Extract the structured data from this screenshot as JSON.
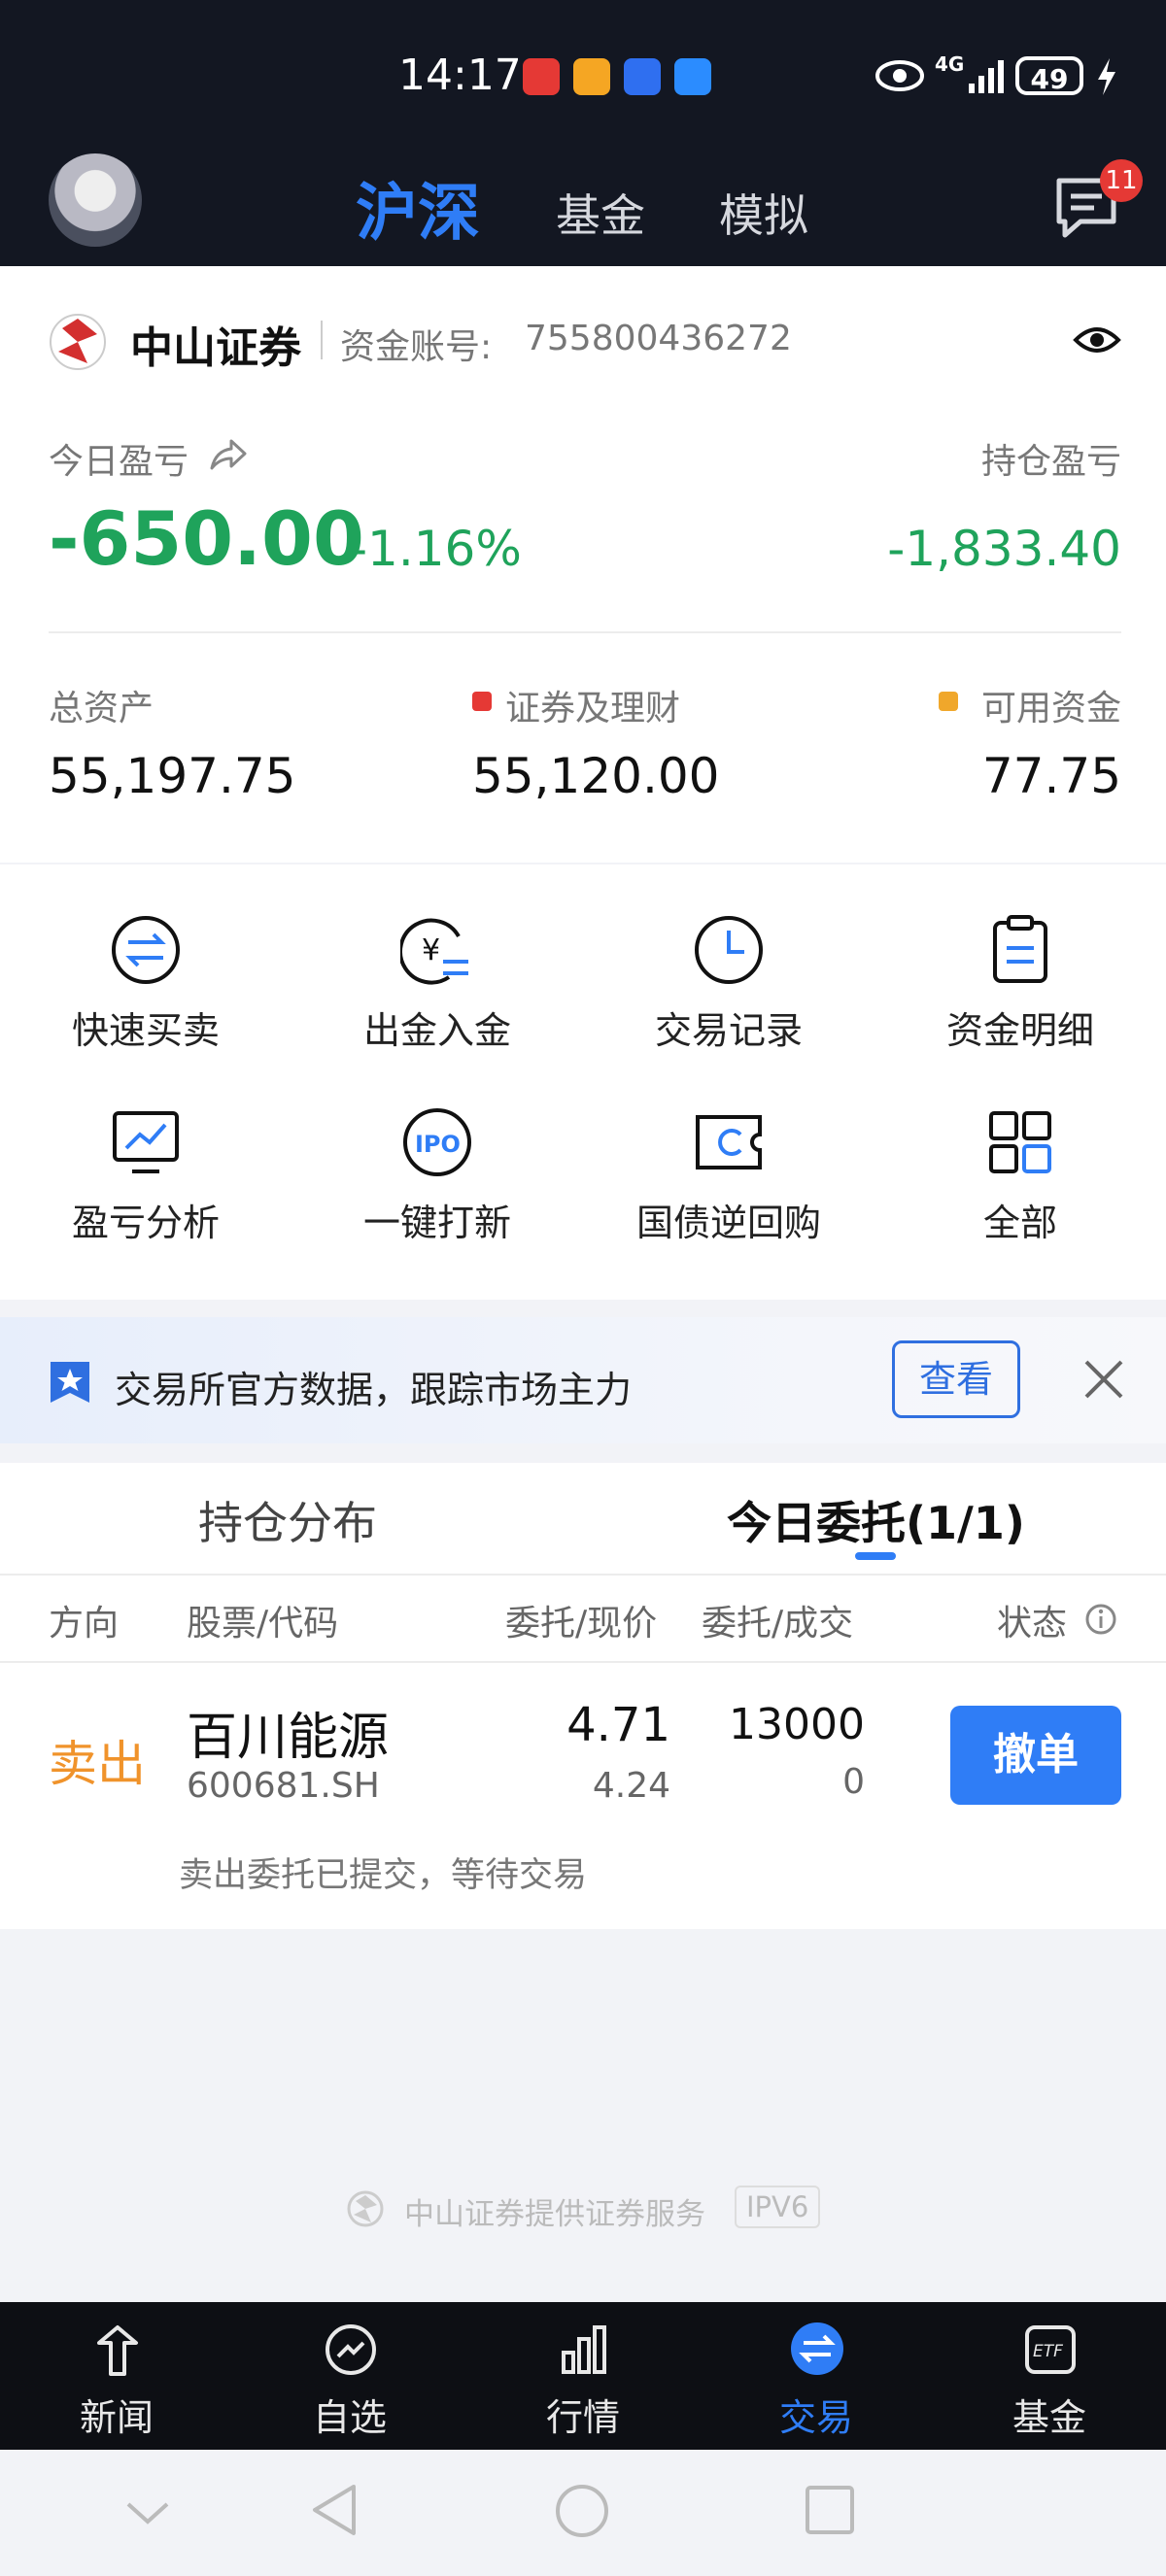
{
  "status_bar": {
    "time": "14:17",
    "battery": "49",
    "network": "4G"
  },
  "header": {
    "tabs": [
      "沪深",
      "基金",
      "模拟"
    ],
    "message_badge": "11"
  },
  "account": {
    "broker": "中山证券",
    "account_label": "资金账号:",
    "account_number": "755800436272",
    "today_pl_label": "今日盈亏",
    "today_pl_value": "-650.00",
    "today_pl_pct": "-1.16%",
    "position_pl_label": "持仓盈亏",
    "position_pl_value": "-1,833.40",
    "total_assets_label": "总资产",
    "total_assets_value": "55,197.75",
    "securities_label": "证券及理财",
    "securities_value": "55,120.00",
    "available_label": "可用资金",
    "available_value": "77.75"
  },
  "quick_actions": [
    {
      "label": "快速买卖",
      "icon": "swap-circle-icon"
    },
    {
      "label": "出金入金",
      "icon": "yen-transfer-icon"
    },
    {
      "label": "交易记录",
      "icon": "clock-icon"
    },
    {
      "label": "资金明细",
      "icon": "clipboard-icon"
    },
    {
      "label": "盈亏分析",
      "icon": "chart-monitor-icon"
    },
    {
      "label": "一键打新",
      "icon": "ipo-icon"
    },
    {
      "label": "国债逆回购",
      "icon": "bond-repo-icon"
    },
    {
      "label": "全部",
      "icon": "grid-icon"
    }
  ],
  "banner": {
    "text": "交易所官方数据，跟踪市场主力",
    "button": "查看"
  },
  "order_tabs": [
    "持仓分布",
    "今日委托(1/1)"
  ],
  "table_headers": [
    "方向",
    "股票/代码",
    "委托/现价",
    "委托/成交",
    "状态"
  ],
  "order": {
    "direction": "卖出",
    "name": "百川能源",
    "code": "600681.SH",
    "order_price": "4.71",
    "current_price": "4.24",
    "order_qty": "13000",
    "filled_qty": "0",
    "cancel_button": "撤单",
    "status_text": "卖出委托已提交，等待交易"
  },
  "footer": {
    "service": "中山证券提供证券服务",
    "ipv6": "IPV6"
  },
  "bottom_nav": [
    "新闻",
    "自选",
    "行情",
    "交易",
    "基金"
  ],
  "colors": {
    "accent": "#2f7df6",
    "profit_loss": "#1fa35b",
    "sell": "#f0932b",
    "dark": "#131722"
  }
}
